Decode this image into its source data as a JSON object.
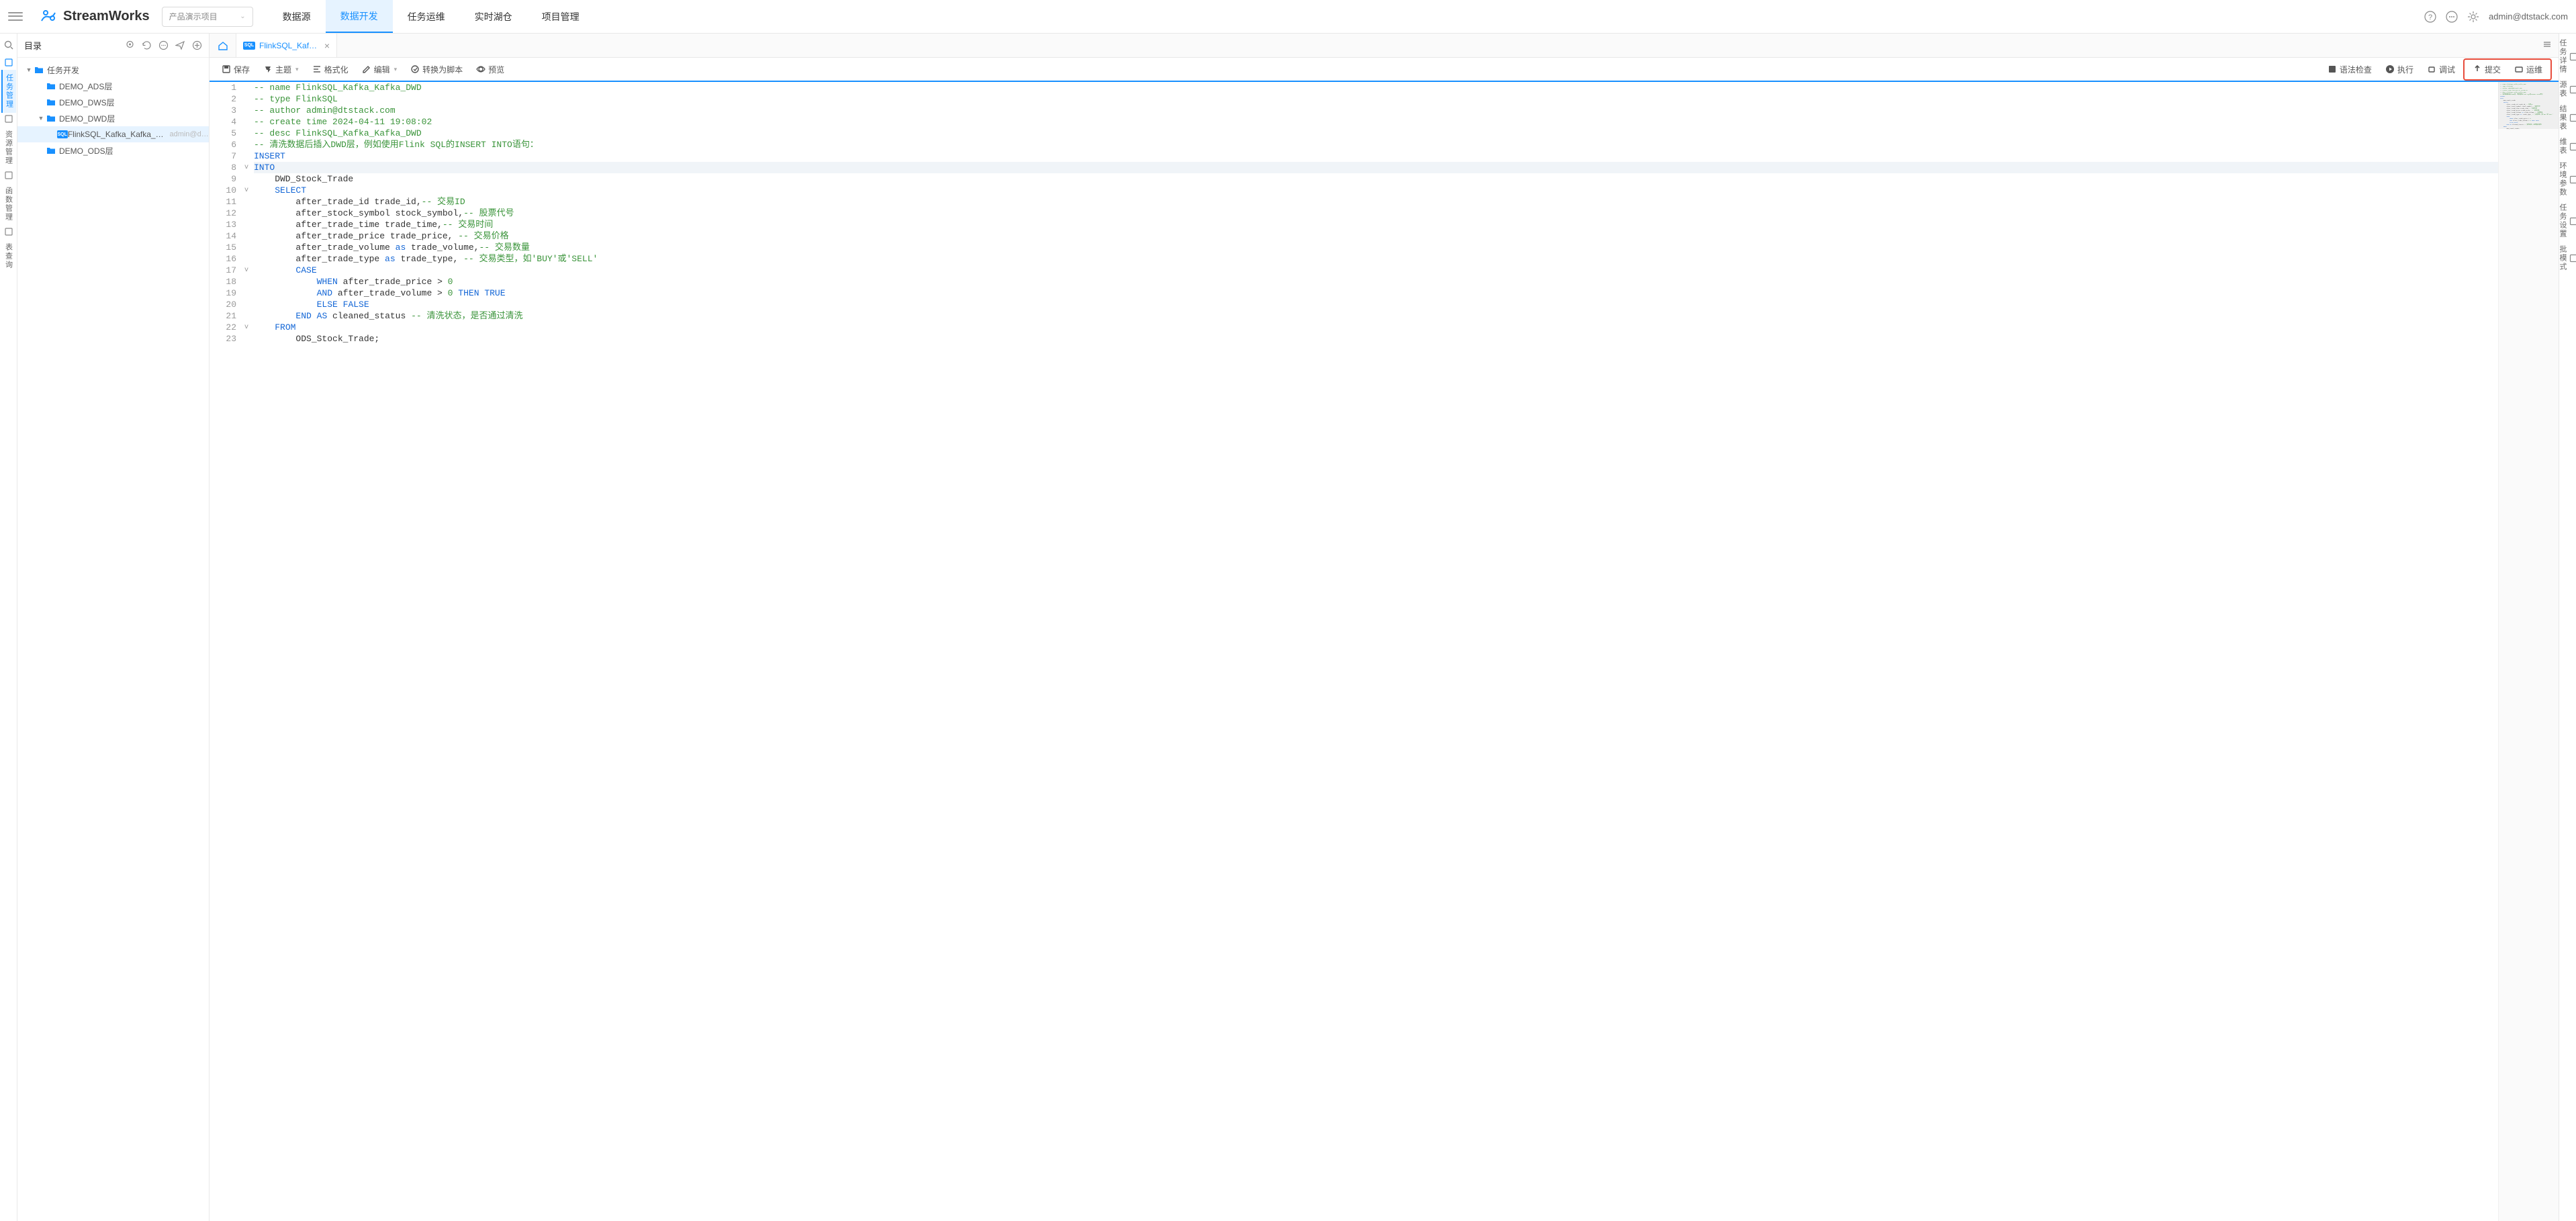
{
  "header": {
    "brand": "StreamWorks",
    "project_select": "产品演示项目",
    "nav": [
      "数据源",
      "数据开发",
      "任务运维",
      "实时湖仓",
      "项目管理"
    ],
    "nav_active_index": 1,
    "user": "admin@dtstack.com"
  },
  "left_rail": {
    "items": [
      "任务管理",
      "资源管理",
      "函数管理",
      "表查询"
    ],
    "active_index": 0
  },
  "sidebar": {
    "title": "目录",
    "root": {
      "label": "任务开发"
    },
    "folders": [
      {
        "label": "DEMO_ADS层"
      },
      {
        "label": "DEMO_DWS层"
      },
      {
        "label": "DEMO_DWD层",
        "expanded": true,
        "children": [
          {
            "label": "FlinkSQL_Kafka_Kafka_DWD",
            "meta": "admin@dts...",
            "selected": true
          }
        ]
      },
      {
        "label": "DEMO_ODS层"
      }
    ]
  },
  "tabs": {
    "open": [
      {
        "label": "FlinkSQL_Kafka_Ka..."
      }
    ]
  },
  "toolbar": {
    "left": [
      {
        "label": "保存",
        "icon": "save"
      },
      {
        "label": "主题",
        "icon": "theme",
        "chev": true
      },
      {
        "label": "格式化",
        "icon": "format"
      },
      {
        "label": "编辑",
        "icon": "edit",
        "chev": true
      },
      {
        "label": "转换为脚本",
        "icon": "convert"
      },
      {
        "label": "预览",
        "icon": "preview"
      }
    ],
    "right": [
      {
        "label": "语法检查",
        "icon": "syntax"
      },
      {
        "label": "执行",
        "icon": "run"
      },
      {
        "label": "调试",
        "icon": "debug"
      }
    ],
    "highlighted": [
      {
        "label": "提交",
        "icon": "submit"
      },
      {
        "label": "运维",
        "icon": "ops"
      }
    ]
  },
  "editor": {
    "current_line": 8,
    "fold_markers": {
      "8": "v",
      "10": "v",
      "17": "v",
      "22": "v"
    },
    "lines": [
      [
        [
          "c-comment",
          "-- name FlinkSQL_Kafka_Kafka_DWD"
        ]
      ],
      [
        [
          "c-comment",
          "-- type FlinkSQL"
        ]
      ],
      [
        [
          "c-comment",
          "-- author admin@dtstack.com"
        ]
      ],
      [
        [
          "c-comment",
          "-- create time 2024-04-11 19:08:02"
        ]
      ],
      [
        [
          "c-comment",
          "-- desc FlinkSQL_Kafka_Kafka_DWD"
        ]
      ],
      [
        [
          "c-comment",
          "-- 清洗数据后插入DWD层，例如使用Flink SQL的INSERT INTO语句："
        ]
      ],
      [
        [
          "c-keyword",
          "INSERT"
        ]
      ],
      [
        [
          "c-keyword",
          "INTO"
        ]
      ],
      [
        [
          "",
          "    DWD_Stock_Trade"
        ]
      ],
      [
        [
          "",
          "    "
        ],
        [
          "c-keyword",
          "SELECT"
        ]
      ],
      [
        [
          "",
          "        after_trade_id trade_id,"
        ],
        [
          "c-comment",
          "-- 交易ID"
        ]
      ],
      [
        [
          "",
          "        after_stock_symbol stock_symbol,"
        ],
        [
          "c-comment",
          "-- 股票代号"
        ]
      ],
      [
        [
          "",
          "        after_trade_time trade_time,"
        ],
        [
          "c-comment",
          "-- 交易时间"
        ]
      ],
      [
        [
          "",
          "        after_trade_price trade_price, "
        ],
        [
          "c-comment",
          "-- 交易价格"
        ]
      ],
      [
        [
          "",
          "        after_trade_volume "
        ],
        [
          "c-keyword",
          "as"
        ],
        [
          "",
          " trade_volume,"
        ],
        [
          "c-comment",
          "-- 交易数量"
        ]
      ],
      [
        [
          "",
          "        after_trade_type "
        ],
        [
          "c-keyword",
          "as"
        ],
        [
          "",
          " trade_type, "
        ],
        [
          "c-comment",
          "-- 交易类型，如'BUY'或'SELL'"
        ]
      ],
      [
        [
          "",
          "        "
        ],
        [
          "c-keyword",
          "CASE"
        ]
      ],
      [
        [
          "",
          "            "
        ],
        [
          "c-keyword",
          "WHEN"
        ],
        [
          "",
          " after_trade_price > "
        ],
        [
          "c-number",
          "0"
        ]
      ],
      [
        [
          "",
          "            "
        ],
        [
          "c-keyword",
          "AND"
        ],
        [
          "",
          " after_trade_volume > "
        ],
        [
          "c-number",
          "0"
        ],
        [
          "",
          " "
        ],
        [
          "c-keyword",
          "THEN"
        ],
        [
          "",
          " "
        ],
        [
          "c-keyword",
          "TRUE"
        ]
      ],
      [
        [
          "",
          "            "
        ],
        [
          "c-keyword",
          "ELSE"
        ],
        [
          "",
          " "
        ],
        [
          "c-keyword",
          "FALSE"
        ]
      ],
      [
        [
          "",
          "        "
        ],
        [
          "c-keyword",
          "END"
        ],
        [
          "",
          " "
        ],
        [
          "c-keyword",
          "AS"
        ],
        [
          "",
          " cleaned_status "
        ],
        [
          "c-comment",
          "-- 清洗状态，是否通过清洗"
        ]
      ],
      [
        [
          "",
          "    "
        ],
        [
          "c-keyword",
          "FROM"
        ]
      ],
      [
        [
          "",
          "        ODS_Stock_Trade;"
        ]
      ]
    ]
  },
  "right_rail": {
    "items": [
      "任务详情",
      "源表",
      "结果表",
      "维表",
      "环境参数",
      "任务设置",
      "批模式"
    ]
  }
}
